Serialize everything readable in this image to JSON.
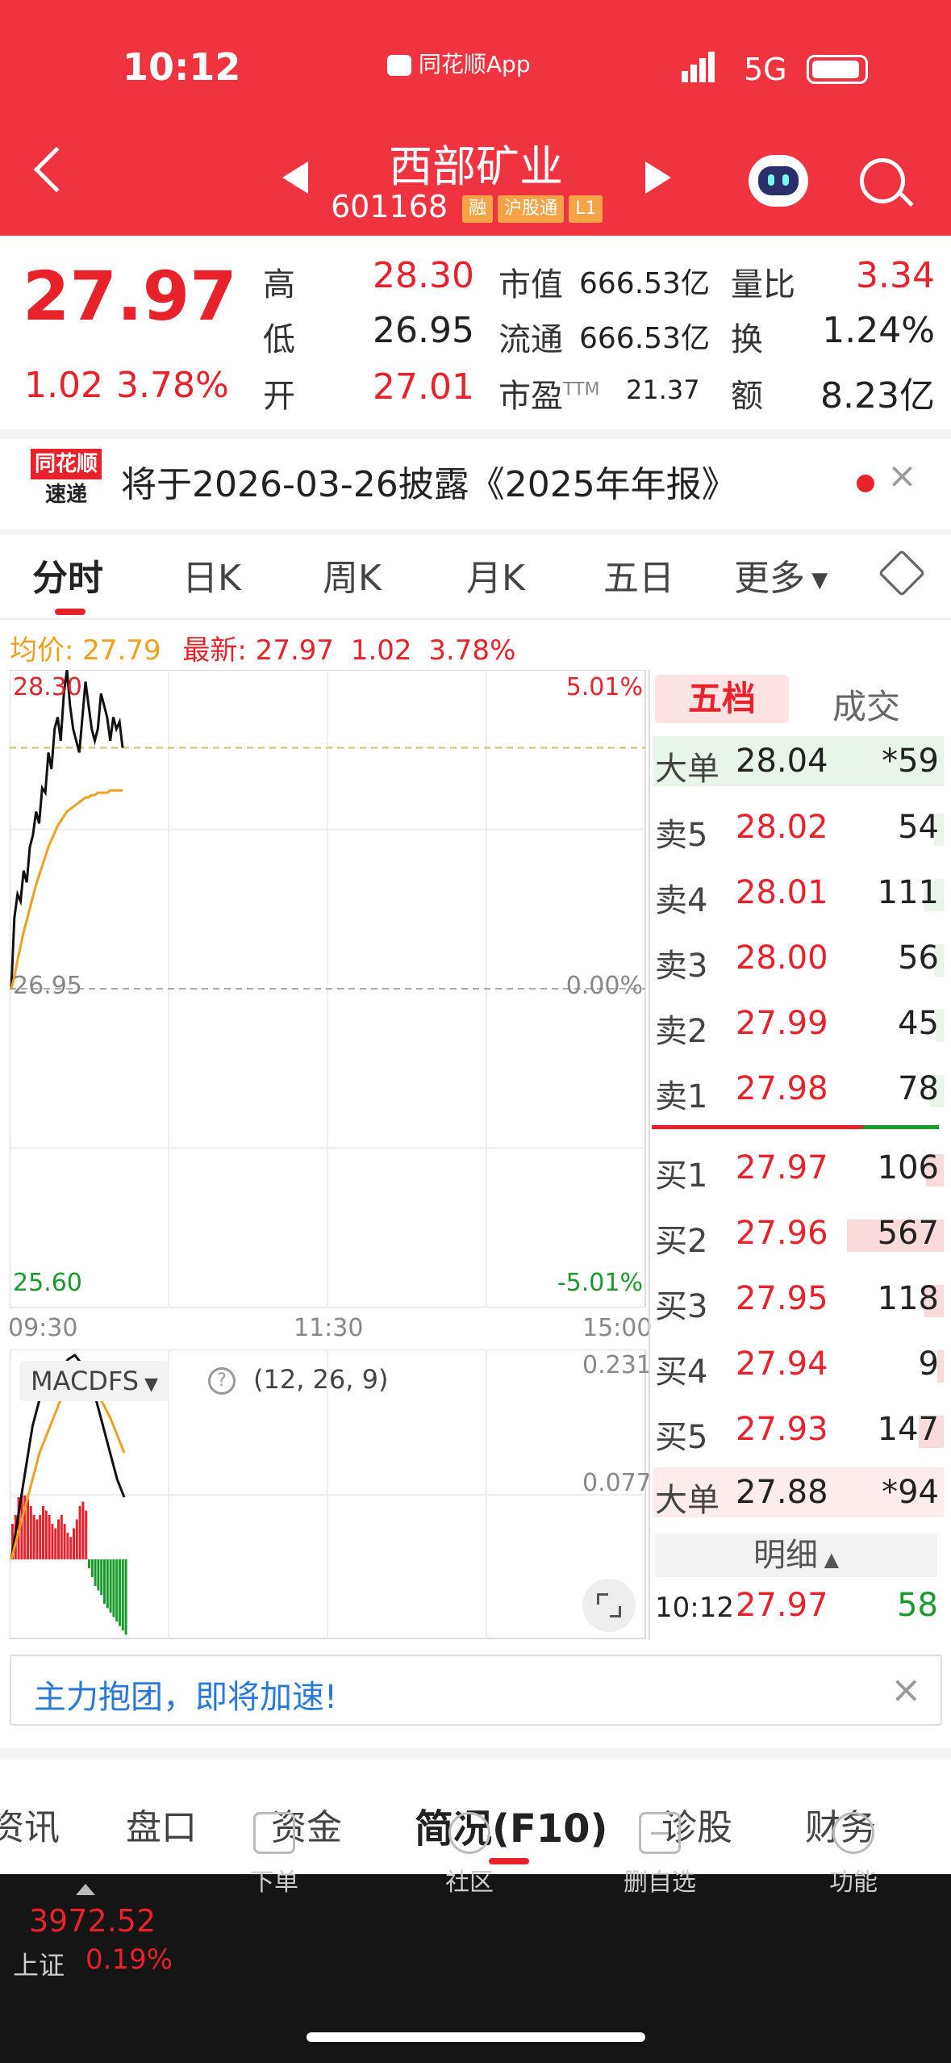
{
  "status_bar": {
    "time": "10:12",
    "app": "同花顺App",
    "network": "5G"
  },
  "header": {
    "title": "西部矿业",
    "code": "601168",
    "tags": [
      "融",
      "沪股通",
      "L1"
    ]
  },
  "quote": {
    "price": "27.97",
    "change": "1.02",
    "change_pct": "3.78%",
    "fields": [
      {
        "label": "高",
        "value": "28.30"
      },
      {
        "label": "低",
        "value": "26.95"
      },
      {
        "label": "开",
        "value": "27.01"
      },
      {
        "label": "市值",
        "value": "666.53亿"
      },
      {
        "label": "流通",
        "value": "666.53亿"
      },
      {
        "label": "市盈",
        "sup": "TTM",
        "value": "21.37"
      },
      {
        "label": "量比",
        "value": "3.34"
      },
      {
        "label": "换",
        "value": "1.24%"
      },
      {
        "label": "额",
        "value": "8.23亿"
      }
    ]
  },
  "notice": {
    "logo_top": "同花顺",
    "logo_bottom": "速递",
    "text": "将于2026-03-26披露《2025年年报》"
  },
  "period_tabs": [
    "分时",
    "日K",
    "周K",
    "月K",
    "五日",
    "更多"
  ],
  "chart_info": {
    "avg_label": "均价: 27.79",
    "latest_label": "最新: 27.97",
    "change": "1.02",
    "change_pct": "3.78%"
  },
  "chart_data": {
    "type": "line",
    "y_high": "28.30",
    "y_mid": "26.95",
    "y_low": "25.60",
    "pct_high": "5.01%",
    "pct_mid": "0.00%",
    "pct_low": "-5.01%",
    "x_ticks": [
      "09:30",
      "11:30",
      "15:00"
    ],
    "ylim": [
      25.6,
      28.3
    ],
    "ref_price": 26.95,
    "series": [
      {
        "values": [
          26.95,
          27.25,
          27.35,
          27.32,
          27.45,
          27.4,
          27.55,
          27.6,
          27.7,
          27.65,
          27.8,
          27.78,
          27.95,
          27.88,
          28.05,
          28.1,
          28.0,
          28.2,
          28.3,
          28.15,
          28.05,
          28.0,
          27.95,
          28.1,
          28.25,
          28.15,
          28.05,
          28.0,
          28.05,
          28.2,
          28.15,
          28.1,
          28.0,
          28.1,
          28.05,
          28.08,
          27.97
        ]
      },
      {
        "values": [
          26.95,
          27.0,
          27.07,
          27.13,
          27.19,
          27.24,
          27.29,
          27.34,
          27.39,
          27.43,
          27.47,
          27.51,
          27.55,
          27.58,
          27.61,
          27.64,
          27.66,
          27.68,
          27.7,
          27.71,
          27.72,
          27.73,
          27.74,
          27.75,
          27.76,
          27.76,
          27.77,
          27.77,
          27.78,
          27.78,
          27.78,
          27.78,
          27.79,
          27.79,
          27.79,
          27.79,
          27.79
        ]
      }
    ]
  },
  "macd": {
    "label": "MACDFS",
    "params": "(12, 26, 9)",
    "high": "0.231",
    "mid": "0.077",
    "bars": [
      0.04,
      0.05,
      0.07,
      0.075,
      0.072,
      0.068,
      0.06,
      0.05,
      0.045,
      0.05,
      0.06,
      0.055,
      0.05,
      0.04,
      0.035,
      0.045,
      0.05,
      0.04,
      0.03,
      0.025,
      0.035,
      0.045,
      0.06,
      0.065,
      0.055,
      -0.01,
      -0.02,
      -0.03,
      -0.035,
      -0.04,
      -0.05,
      -0.055,
      -0.06,
      -0.065,
      -0.07,
      -0.075,
      -0.08,
      -0.085
    ],
    "dif": [
      0.0,
      0.05,
      0.1,
      0.15,
      0.18,
      0.19,
      0.2,
      0.21,
      0.225,
      0.23,
      0.22,
      0.2,
      0.18,
      0.15,
      0.12,
      0.09,
      0.07
    ],
    "dea": [
      0.0,
      0.03,
      0.06,
      0.09,
      0.12,
      0.14,
      0.16,
      0.18,
      0.195,
      0.2,
      0.205,
      0.2,
      0.19,
      0.175,
      0.16,
      0.14,
      0.12
    ]
  },
  "order_book": {
    "tabs": [
      "五档",
      "成交"
    ],
    "big_sell": {
      "label": "大单",
      "price": "28.04",
      "vol": "*59"
    },
    "asks": [
      {
        "label": "卖5",
        "price": "28.02",
        "vol": "54",
        "bar": 0.1
      },
      {
        "label": "卖4",
        "price": "28.01",
        "vol": "111",
        "bar": 0.2
      },
      {
        "label": "卖3",
        "price": "28.00",
        "vol": "56",
        "bar": 0.1
      },
      {
        "label": "卖2",
        "price": "27.99",
        "vol": "45",
        "bar": 0.08
      },
      {
        "label": "卖1",
        "price": "27.98",
        "vol": "78",
        "bar": 0.14
      }
    ],
    "bids": [
      {
        "label": "买1",
        "price": "27.97",
        "vol": "106",
        "bar": 0.18
      },
      {
        "label": "买2",
        "price": "27.96",
        "vol": "567",
        "bar": 1.0
      },
      {
        "label": "买3",
        "price": "27.95",
        "vol": "118",
        "bar": 0.2
      },
      {
        "label": "买4",
        "price": "27.94",
        "vol": "9",
        "bar": 0.02
      },
      {
        "label": "买5",
        "price": "27.93",
        "vol": "147",
        "bar": 0.26
      }
    ],
    "big_buy": {
      "label": "大单",
      "price": "27.88",
      "vol": "*94"
    },
    "detail_label": "明细",
    "tick": {
      "time": "10:12",
      "price": "27.97",
      "vol": "58"
    }
  },
  "banner": {
    "text": "主力抱团，即将加速!"
  },
  "bottom_tabs": [
    "资讯",
    "盘口",
    "资金",
    "简况(F10)",
    "诊股",
    "财务"
  ],
  "index": {
    "value": "3972.52",
    "name": "上证",
    "pct": "0.19%"
  },
  "nav": [
    "下单",
    "社区",
    "删自选",
    "功能"
  ]
}
